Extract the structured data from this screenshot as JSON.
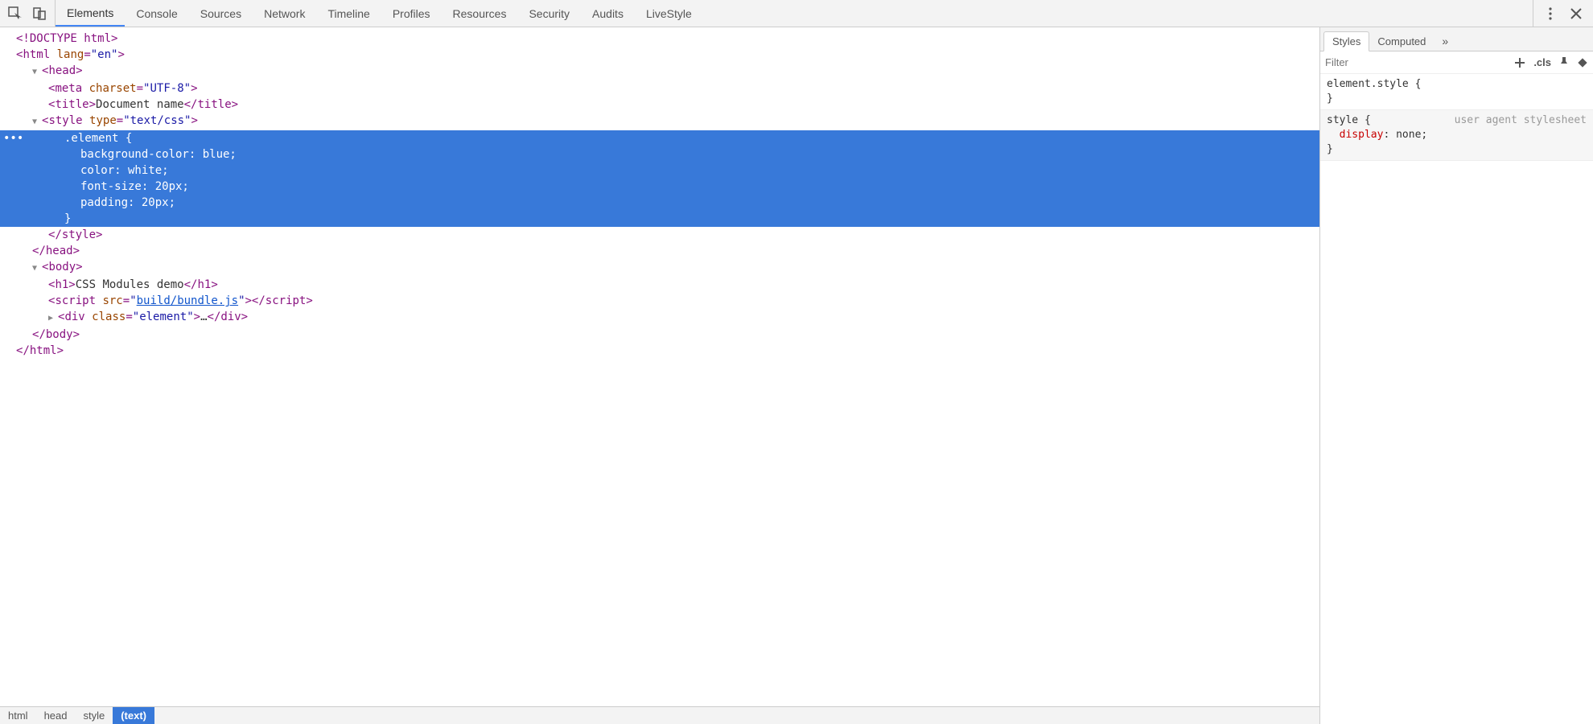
{
  "toolbar": {
    "tabs": [
      "Elements",
      "Console",
      "Sources",
      "Network",
      "Timeline",
      "Profiles",
      "Resources",
      "Security",
      "Audits",
      "LiveStyle"
    ],
    "active_tab": 0
  },
  "dom": {
    "doctype": "<!DOCTYPE html>",
    "html_open": {
      "tag": "html",
      "attr": "lang",
      "val": "\"en\""
    },
    "head_open": "head",
    "meta": {
      "tag": "meta",
      "attr": "charset",
      "val": "\"UTF-8\""
    },
    "title": {
      "open": "title",
      "text": "Document name",
      "close": "/title"
    },
    "style_open": {
      "tag": "style",
      "attr": "type",
      "val": "\"text/css\""
    },
    "css_sel": ".element {",
    "css_l1": "background-color: blue;",
    "css_l2": "color: white;",
    "css_l3": "font-size: 20px;",
    "css_l4": "padding: 20px;",
    "css_close": "}",
    "style_close": "/style",
    "head_close": "/head",
    "body_open": "body",
    "h1": {
      "open": "h1",
      "text": "CSS Modules demo",
      "close": "/h1"
    },
    "script": {
      "tag": "script",
      "attr": "src",
      "val_pre": "\"",
      "val_link": "build/bundle.js",
      "val_post": "\"",
      "close": "/script"
    },
    "div": {
      "tag": "div",
      "attr": "class",
      "val": "\"element\"",
      "ell": "…",
      "close": "/div"
    },
    "body_close": "/body",
    "html_close": "/html",
    "gutter_dots": "•••"
  },
  "crumbs": [
    "html",
    "head",
    "style",
    "(text)"
  ],
  "side": {
    "tabs": [
      "Styles",
      "Computed"
    ],
    "more": "»",
    "filter_placeholder": "Filter",
    "cls": ".cls",
    "rule1_sel": "element.style {",
    "rule1_close": "}",
    "rule2_sel": "style {",
    "rule2_ua": "user agent stylesheet",
    "rule2_prop": "display",
    "rule2_val": "none;",
    "rule2_close": "}"
  }
}
